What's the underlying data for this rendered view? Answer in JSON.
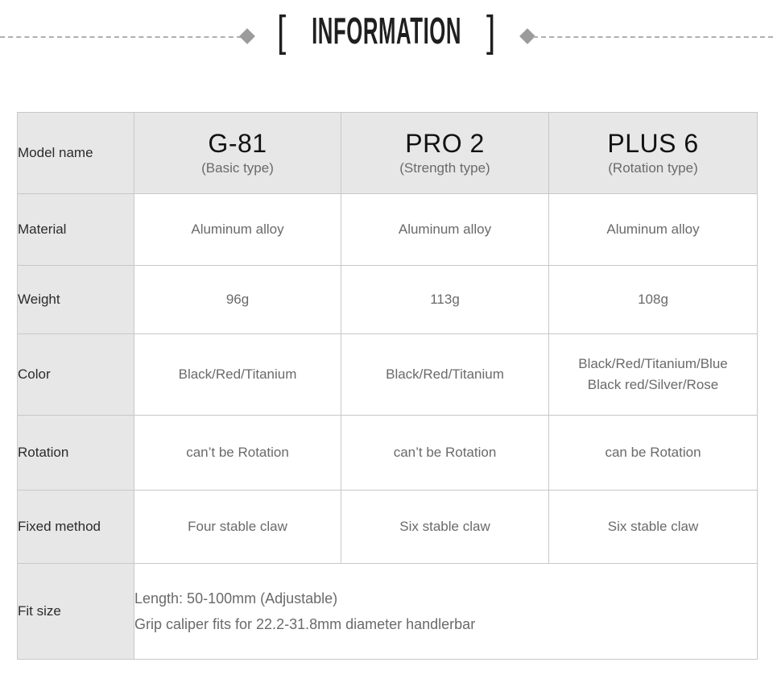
{
  "banner": {
    "bracket_open": "[",
    "bracket_close": "]",
    "title": "INFORMATION"
  },
  "table": {
    "columns": [
      {
        "key": "label",
        "header": ""
      },
      {
        "key": "g81",
        "name": "G-81",
        "subtitle": "(Basic type)"
      },
      {
        "key": "pro2",
        "name": "PRO 2",
        "subtitle": "(Strength type)"
      },
      {
        "key": "plus6",
        "name": "PLUS 6",
        "subtitle": "(Rotation type)"
      }
    ],
    "rows": [
      {
        "label": "Model name",
        "g81": "G-81",
        "g81_sub": "(Basic type)",
        "pro2": "PRO 2",
        "pro2_sub": "(Strength type)",
        "plus6": "PLUS 6",
        "plus6_sub": "(Rotation type)"
      },
      {
        "label": "Material",
        "g81": "Aluminum alloy",
        "pro2": "Aluminum alloy",
        "plus6": "Aluminum alloy"
      },
      {
        "label": "Weight",
        "g81": "96g",
        "pro2": "113g",
        "plus6": "108g"
      },
      {
        "label": "Color",
        "g81": "Black/Red/Titanium",
        "pro2": "Black/Red/Titanium",
        "plus6_line1": "Black/Red/Titanium/Blue",
        "plus6_line2": "Black red/Silver/Rose"
      },
      {
        "label": "Rotation",
        "g81": "can’t be Rotation",
        "pro2": "can’t be Rotation",
        "plus6": "can be Rotation"
      },
      {
        "label": "Fixed method",
        "g81": "Four stable claw",
        "pro2": "Six stable claw",
        "plus6": "Six stable claw"
      },
      {
        "label": "Fit size",
        "line1": "Length: 50-100mm (Adjustable)",
        "line2": "Grip caliper fits for 22.2-31.8mm diameter handlerbar"
      }
    ]
  },
  "colors": {
    "header_bg": "#e7e7e7",
    "label_bg": "#e7e7e7",
    "cell_bg": "#ffffff",
    "border": "#c8c8c8",
    "title_text": "#1f1f1f",
    "label_text": "#2b2b2b",
    "value_text": "#6a6a6a",
    "model_text": "#121212",
    "diamond": "#9b9b9b",
    "rule": "#b0b0b0"
  }
}
